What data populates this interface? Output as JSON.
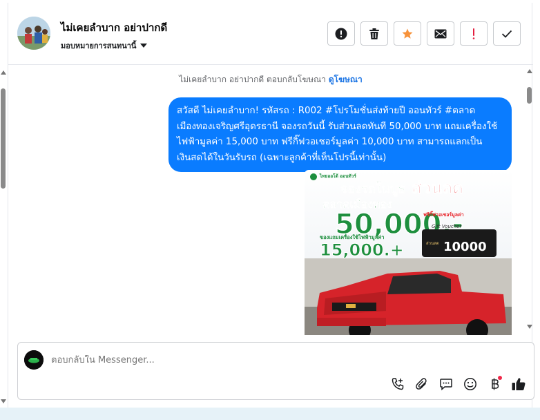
{
  "contact": {
    "name": "ไม่เคยลำบาก อย่าปากดี",
    "assign_label": "มอบหมายการสนทนานี้"
  },
  "actions": [
    {
      "name": "mark-spam-button",
      "icon": "alert-circle-icon"
    },
    {
      "name": "delete-button",
      "icon": "trash-icon"
    },
    {
      "name": "star-button",
      "icon": "star-icon",
      "color": "#f7923a"
    },
    {
      "name": "mark-unread-button",
      "icon": "envelope-icon"
    },
    {
      "name": "follow-up-button",
      "icon": "exclamation-icon",
      "color": "#e41e3f"
    },
    {
      "name": "mark-done-button",
      "icon": "checkmark-icon"
    }
  ],
  "thread": {
    "system_text": "ไม่เคยลำบาก อย่าปากดี ตอบกลับโฆษณา",
    "system_link": "ดูโฆษณา",
    "message": "สวัสดี ไม่เคยลำบาก! รหัสรถ : R002 #โปรโมชั่นส่งท้ายปี ออนทัวร์ #ตลาดเมืองทองเจริญศรีอุดรธานี จองรถวันนี้ รับส่วนลดทันที 50,000 บาท แถมเครื่องใช้ไฟฟ้ามูลค่า 15,000 บาท ฟรีกิ๊ฟวอเชอร์มูลค่า 10,000 บาท สามารถแลกเป็นเงินสดได้ในวันรับรถ (เฉพาะลูกค้าที่เห็นโปรนี้เท่านั้น)",
    "ad": {
      "logo_text": "ไทยออโต้ ออนทัวร์",
      "line1": "จองรถในบูธ",
      "line1b": "ส่วนลด",
      "line2": "ตลาดเมืองทอง",
      "big": "50,000.-",
      "side": "ฟรีกิ๊ฟวอเชอร์มูลค่า",
      "voucher": "Gift Voucher",
      "voucher_small": "ส่วนลด",
      "voucher_amount": "10000",
      "gift_label": "ของแถมเครื่องใช้ไฟฟ้ามูลค่า",
      "gift_amount": "15,000.+",
      "colors": {
        "green": "#1e8f3e",
        "red": "#e8242a",
        "truck": "#d6232a"
      }
    }
  },
  "composer": {
    "placeholder": "ตอบกลับใน Messenger...",
    "tools": [
      "call-add-icon",
      "paperclip-icon",
      "chat-bubble-icon",
      "emoji-icon",
      "baht-icon",
      "thumbs-up-icon"
    ]
  },
  "accent": "#0a7cff"
}
